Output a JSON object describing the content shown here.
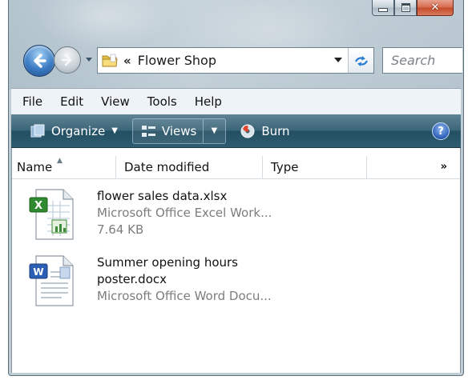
{
  "window": {
    "caption_buttons": [
      "minimize",
      "maximize",
      "close"
    ]
  },
  "navigation": {
    "breadcrumb_prefix": "«",
    "address": "Flower Shop",
    "search_placeholder": "Search"
  },
  "menu": {
    "items": [
      "File",
      "Edit",
      "View",
      "Tools",
      "Help"
    ]
  },
  "commandbar": {
    "organize_label": "Organize",
    "views_label": "Views",
    "burn_label": "Burn",
    "help_label": "?"
  },
  "columns": {
    "name": "Name",
    "date": "Date modified",
    "type": "Type",
    "more": "»"
  },
  "files": [
    {
      "icon": "excel-file-icon",
      "name": "flower sales data.xlsx",
      "type": "Microsoft Office Excel Work...",
      "size": "7.64 KB"
    },
    {
      "icon": "word-file-icon",
      "name_line1": "Summer opening hours",
      "name_line2": "poster.docx",
      "type": "Microsoft Office Word Docu..."
    }
  ],
  "colors": {
    "command_bar": "#2f5c70",
    "close_button": "#c34a2a",
    "menu_bar": "#eef3f7"
  }
}
